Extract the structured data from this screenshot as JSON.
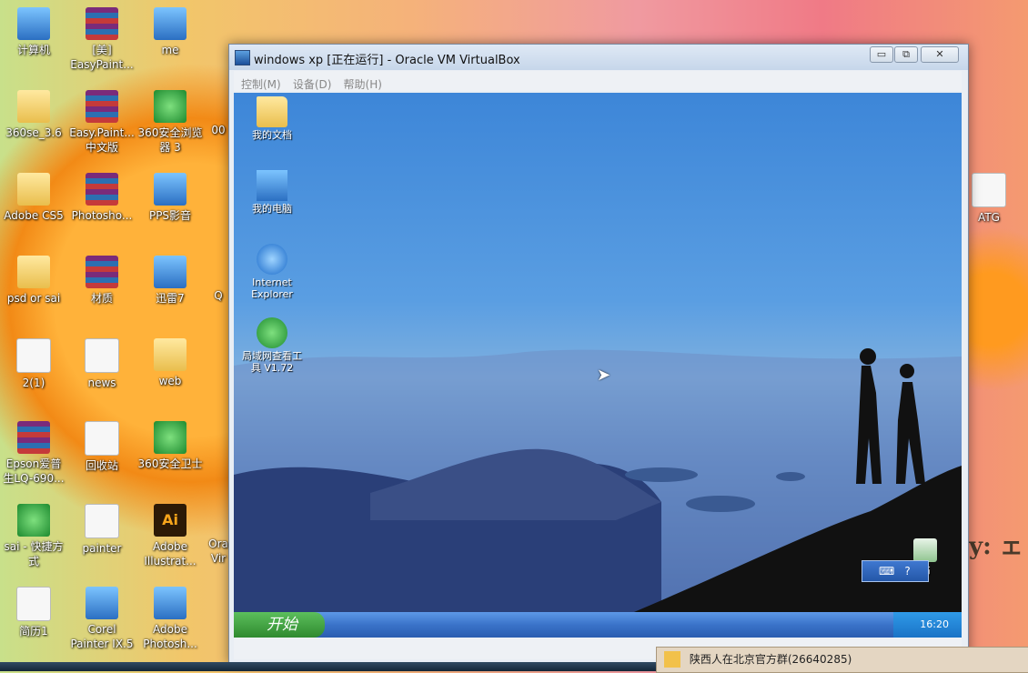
{
  "desktop": {
    "icons": [
      {
        "label": "计算机"
      },
      {
        "label": "[美]\nEasyPaint..."
      },
      {
        "label": "me"
      },
      {
        "label": "360se_3.6"
      },
      {
        "label": "Easy.Paint...\n中文版"
      },
      {
        "label": "360安全浏览\n器 3"
      },
      {
        "label": "Adobe CS5"
      },
      {
        "label": "Photosho..."
      },
      {
        "label": "PPS影音"
      },
      {
        "label": "psd or sai"
      },
      {
        "label": "材质"
      },
      {
        "label": "迅雷7"
      },
      {
        "label": "2(1)"
      },
      {
        "label": "news"
      },
      {
        "label": "web"
      },
      {
        "label": "Epson爱普\n生LQ-690..."
      },
      {
        "label": "回收站"
      },
      {
        "label": "360安全卫士"
      },
      {
        "label": "sai - 快捷方\n式"
      },
      {
        "label": "painter"
      },
      {
        "label": "Adobe\nIllustrat..."
      },
      {
        "label": "简历1"
      },
      {
        "label": "Corel\nPainter IX.5"
      },
      {
        "label": "Adobe\nPhotosh..."
      },
      {
        "label": "ATG"
      }
    ],
    "partial_labels": [
      "00",
      "Q",
      "Ora\nVir"
    ],
    "wallpaper_fragment": "y:  ェ"
  },
  "vm_window": {
    "title": "windows  xp [正在运行] - Oracle VM VirtualBox",
    "menu": [
      "控制(M)",
      "设备(D)",
      "帮助(H)"
    ],
    "buttons": {
      "minimize": "▭",
      "restore": "⧉",
      "close": "✕"
    }
  },
  "guest": {
    "icons": [
      {
        "label": "我的文档"
      },
      {
        "label": "我的电脑"
      },
      {
        "label": "Internet\nExplorer"
      },
      {
        "label": "局域网查看工\n具 V1.72"
      }
    ],
    "recycle_partial": "站",
    "start_label": "开始",
    "clock": "16:20"
  },
  "notification": {
    "text": "陕西人在北京官方群(26640285)"
  },
  "colors": {
    "xp_taskbar": "#3a73c9",
    "start_green": "#2f8a2f",
    "titlebar": "#c6d6ea"
  }
}
